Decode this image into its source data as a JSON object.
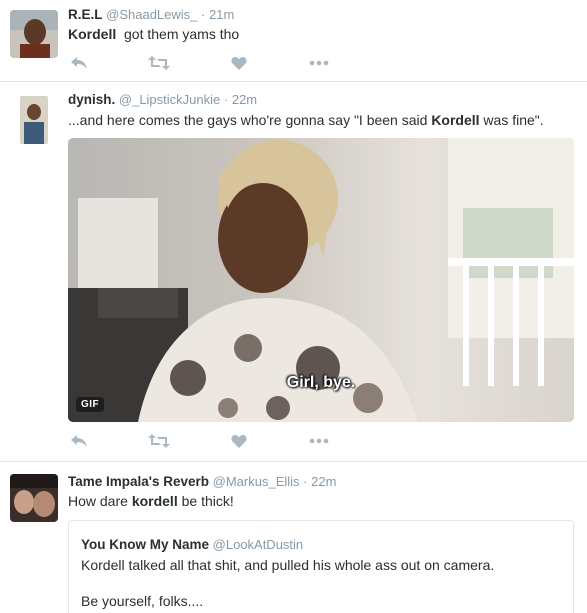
{
  "tweets": [
    {
      "name": "R.E.L",
      "handle": "@ShaadLewis_",
      "separator": "·",
      "time": "21m",
      "text_kw": "Kordell",
      "text_rest": "  got them yams tho"
    },
    {
      "name": "dynish.",
      "handle": "@_LipstickJunkie",
      "separator": "·",
      "time": "22m",
      "text_pre": "...and here comes the gays who're gonna say \"I been said ",
      "text_kw": "Kordell",
      "text_post": " was fine\".",
      "media": {
        "badge": "GIF",
        "caption": "Girl, bye."
      }
    },
    {
      "name": "Tame Impala's Reverb",
      "handle": "@Markus_Ellis",
      "separator": "·",
      "time": "22m",
      "text_pre": "How dare ",
      "text_kw": "kordell",
      "text_post": " be thick!",
      "quote": {
        "name": "You Know My Name",
        "handle": "@LookAtDustin",
        "line1": "Kordell talked all that shit, and pulled his whole ass out on camera.",
        "line2": "Be yourself, folks...."
      }
    }
  ],
  "icons": [
    "reply-icon",
    "retweet-icon",
    "like-icon",
    "more-icon"
  ],
  "colors": {
    "name": "#292f33",
    "meta": "#8899a6",
    "action": "#aab8c2",
    "divider": "#e1e8ed"
  }
}
